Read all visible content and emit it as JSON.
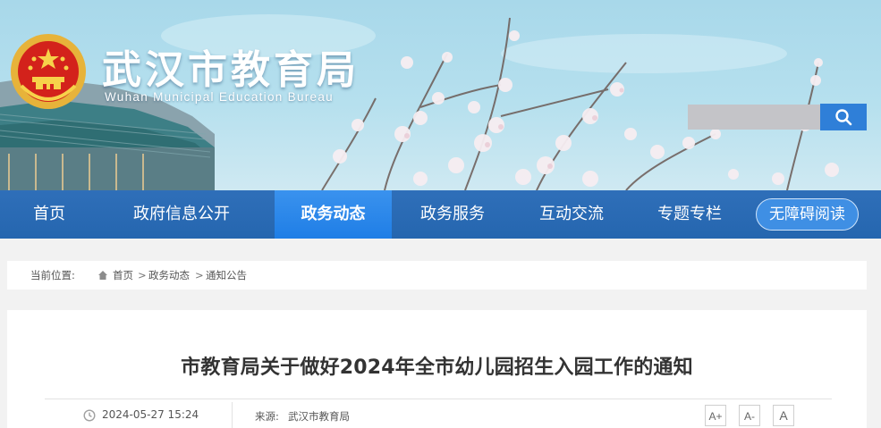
{
  "header": {
    "title": "武汉市教育局",
    "subtitle": "Wuhan Municipal Education Bureau"
  },
  "search": {
    "value": "",
    "icon": "search-icon"
  },
  "nav": {
    "items": [
      {
        "label": "首页",
        "active": false
      },
      {
        "label": "政府信息公开",
        "active": false
      },
      {
        "label": "政务动态",
        "active": true
      },
      {
        "label": "政务服务",
        "active": false
      },
      {
        "label": "互动交流",
        "active": false
      },
      {
        "label": "专题专栏",
        "active": false
      }
    ],
    "accessibility_label": "无障碍阅读"
  },
  "breadcrumb": {
    "label": "当前位置:",
    "items": [
      "首页",
      "政务动态",
      "通知公告"
    ],
    "separator": ">"
  },
  "article": {
    "title": "市教育局关于做好2024年全市幼儿园招生入园工作的通知",
    "date": "2024-05-27 15:24",
    "source_label": "来源:",
    "source": "武汉市教育局",
    "font_controls": [
      "A+",
      "A-",
      "A"
    ]
  },
  "colors": {
    "nav_bg": "#2566af",
    "nav_active": "#1f7ee6",
    "search_button": "#2f7fd8",
    "page_bg": "#f2f2f2"
  }
}
